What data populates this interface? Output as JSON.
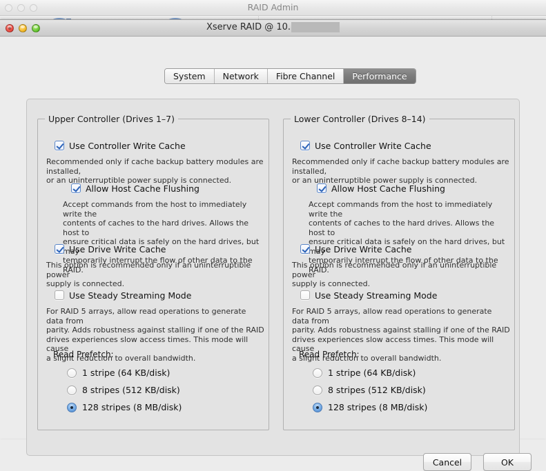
{
  "background_window": {
    "title": "RAID Admin",
    "traffic_lights": [
      "close",
      "minimize",
      "zoom"
    ]
  },
  "window": {
    "title_prefix": "Xserve RAID  @ 10.",
    "title_redacted": true,
    "traffic_lights": [
      "close",
      "minimize",
      "zoom"
    ]
  },
  "tabs": [
    {
      "label": "System",
      "selected": false
    },
    {
      "label": "Network",
      "selected": false
    },
    {
      "label": "Fibre Channel",
      "selected": false
    },
    {
      "label": "Performance",
      "selected": true
    }
  ],
  "panels": [
    {
      "title": "Upper Controller (Drives 1–7)",
      "controller_write_cache": {
        "label": "Use Controller Write Cache",
        "checked": true,
        "description": "Recommended only if cache backup battery modules are installed,\nor an uninterruptible power supply is connected."
      },
      "host_cache_flushing": {
        "label": "Allow Host Cache Flushing",
        "checked": true,
        "description": "Accept commands from the host to immediately write the\ncontents of caches to the hard drives. Allows the host to\nensure critical data is safely on the hard drives, but may\ntemporarily interrupt the flow of other data to the RAID."
      },
      "drive_write_cache": {
        "label": "Use Drive Write Cache",
        "checked": true,
        "description": "This option is recommended only if an uninterruptible power\nsupply is connected."
      },
      "steady_streaming_mode": {
        "label": "Use Steady Streaming Mode",
        "checked": false,
        "description": "For RAID 5 arrays, allow read operations to generate data from\nparity. Adds robustness against stalling if one of the RAID\ndrives experiences slow access times. This mode will cause\na slight reduction to overall bandwidth."
      },
      "read_prefetch": {
        "label": "Read Prefetch:",
        "options": [
          {
            "label": "1 stripe (64 KB/disk)",
            "selected": false
          },
          {
            "label": "8 stripes (512 KB/disk)",
            "selected": false
          },
          {
            "label": "128 stripes (8 MB/disk)",
            "selected": true
          }
        ]
      }
    },
    {
      "title": "Lower Controller (Drives 8–14)",
      "controller_write_cache": {
        "label": "Use Controller Write Cache",
        "checked": true,
        "description": "Recommended only if cache backup battery modules are installed,\nor an uninterruptible power supply is connected."
      },
      "host_cache_flushing": {
        "label": "Allow Host Cache Flushing",
        "checked": true,
        "description": "Accept commands from the host to immediately write the\ncontents of caches to the hard drives. Allows the host to\nensure critical data is safely on the hard drives, but may\ntemporarily interrupt the flow of other data to the RAID."
      },
      "drive_write_cache": {
        "label": "Use Drive Write Cache",
        "checked": true,
        "description": "This option is recommended only if an uninterruptible power\nsupply is connected."
      },
      "steady_streaming_mode": {
        "label": "Use Steady Streaming Mode",
        "checked": false,
        "description": "For RAID 5 arrays, allow read operations to generate data from\nparity. Adds robustness against stalling if one of the RAID\ndrives experiences slow access times. This mode will cause\na slight reduction to overall bandwidth."
      },
      "read_prefetch": {
        "label": "Read Prefetch:",
        "options": [
          {
            "label": "1 stripe (64 KB/disk)",
            "selected": false
          },
          {
            "label": "8 stripes (512 KB/disk)",
            "selected": false
          },
          {
            "label": "128 stripes (8 MB/disk)",
            "selected": true
          }
        ]
      }
    }
  ],
  "footer": {
    "cancel_label": "Cancel",
    "ok_label": "OK"
  },
  "colors": {
    "accent_blue": "#4b87cf",
    "window_bg": "#ececec",
    "panel_bg": "#e3e3e3",
    "selected_tab_bg": "#7b7b7b",
    "redaction_gray": "#b9b9b9"
  }
}
